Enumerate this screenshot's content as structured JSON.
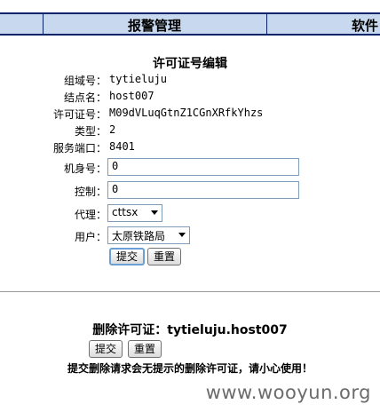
{
  "nav": {
    "tabs": [
      {
        "label": "报警管理"
      },
      {
        "label": "软件"
      }
    ]
  },
  "form": {
    "title": "许可证号编辑",
    "fields": {
      "domain": {
        "label": "组域号：",
        "value": "tytieluju"
      },
      "node": {
        "label": "结点名：",
        "value": "host007"
      },
      "license": {
        "label": "许可证号：",
        "value": "M09dVLuqGtnZ1CGnXRfkYhzs"
      },
      "type": {
        "label": "类型：",
        "value": "2"
      },
      "port": {
        "label": "服务端口：",
        "value": "8401"
      },
      "machine": {
        "label": "机身号：",
        "value": "0"
      },
      "control": {
        "label": "控制：",
        "value": "0"
      },
      "agent": {
        "label": "代理：",
        "value": "cttsx"
      },
      "user": {
        "label": "用户：",
        "value": "太原铁路局"
      }
    },
    "submit_label": "提交",
    "reset_label": "重置"
  },
  "delete": {
    "title": "删除许可证：tytieluju.host007",
    "submit_label": "提交",
    "reset_label": "重置",
    "warning": "提交删除请求会无提示的删除许可证，请小心使用！"
  },
  "watermark": "www.wooyun.org"
}
